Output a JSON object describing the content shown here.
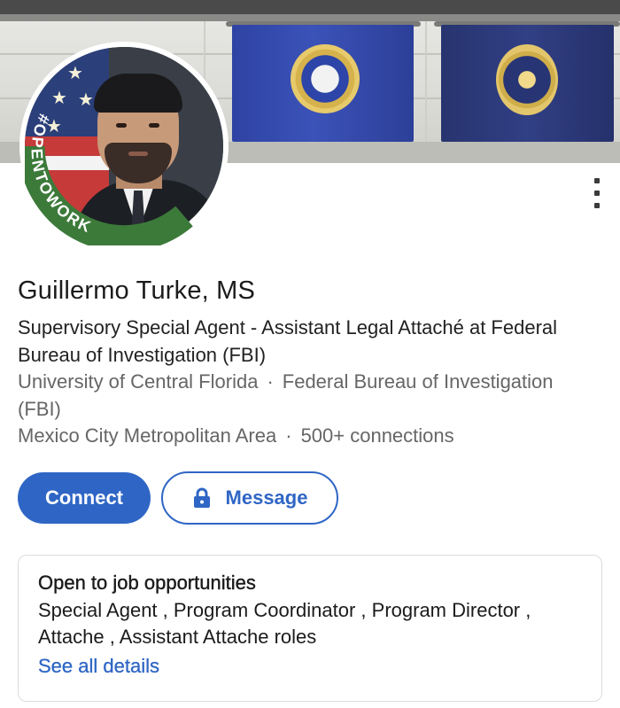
{
  "profile": {
    "name": "Guillermo Turke, MS",
    "headline": "Supervisory Special Agent - Assistant Legal Attaché at Federal Bureau of Investigation (FBI)",
    "education": "University of Central Florida",
    "separator": "·",
    "company": "Federal Bureau of Investigation (FBI)",
    "location": "Mexico City Metropolitan Area",
    "connections": "500+ connections",
    "open_to_work_badge": "#OPENTOWORK"
  },
  "actions": {
    "connect_label": "Connect",
    "message_label": "Message",
    "more_icon": "more-vertical-icon",
    "lock_icon": "lock-icon"
  },
  "open_to_work_card": {
    "title": "Open to job opportunities",
    "roles": "Special Agent , Program Coordinator , Program Director , Attache , Assistant Attache roles",
    "link": "See all details"
  },
  "colors": {
    "primary": "#2f66c5",
    "open_to_work_green": "#3c7a3a",
    "secondary_text": "#666666"
  }
}
